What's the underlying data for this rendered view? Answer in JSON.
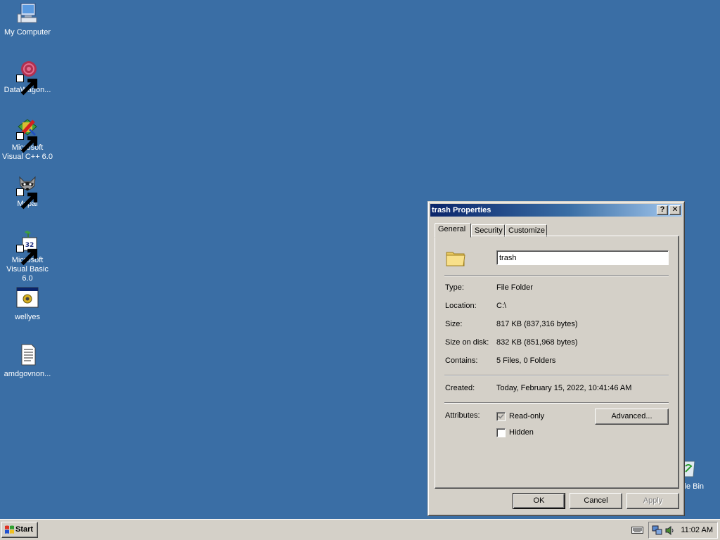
{
  "desktop": {
    "icons": [
      {
        "label": "My Computer",
        "icon": "computer-icon"
      },
      {
        "label": "DataWagon...",
        "icon": "datawagon-icon"
      },
      {
        "label": "Microsoft Visual C++ 6.0",
        "icon": "visual-cpp-icon"
      },
      {
        "label": "Mypal",
        "icon": "mypal-raccoon-icon"
      },
      {
        "label": "Microsoft Visual Basic 6.0",
        "icon": "visual-basic-icon"
      },
      {
        "label": "wellyes",
        "icon": "application-window-icon"
      },
      {
        "label": "amdgovnon...",
        "icon": "text-document-icon"
      }
    ],
    "recycle_bin_label": "cle Bin"
  },
  "dialog": {
    "title": "trash Properties",
    "help_button": "?",
    "close_button": "✕",
    "tabs": [
      {
        "label": "General",
        "active": true
      },
      {
        "label": "Security",
        "active": false
      },
      {
        "label": "Customize",
        "active": false
      }
    ],
    "name_value": "trash",
    "properties": [
      {
        "label": "Type:",
        "value": "File Folder"
      },
      {
        "label": "Location:",
        "value": "C:\\"
      },
      {
        "label": "Size:",
        "value": "817 KB (837,316 bytes)"
      },
      {
        "label": "Size on disk:",
        "value": "832 KB (851,968 bytes)"
      },
      {
        "label": "Contains:",
        "value": "5 Files, 0 Folders"
      }
    ],
    "created": {
      "label": "Created:",
      "value": "Today, February 15, 2022, 10:41:46 AM"
    },
    "attributes_label": "Attributes:",
    "readonly": {
      "label": "Read-only",
      "checked": true
    },
    "hidden": {
      "label": "Hidden",
      "checked": false
    },
    "advanced_button": "Advanced...",
    "ok_button": "OK",
    "cancel_button": "Cancel",
    "apply_button": "Apply"
  },
  "taskbar": {
    "start_label": "Start",
    "clock": "11:02 AM"
  },
  "colors": {
    "desktop": "#3a6ea5",
    "titlebar_start": "#0a246a",
    "titlebar_end": "#a6caf0",
    "face": "#d4d0c8"
  }
}
